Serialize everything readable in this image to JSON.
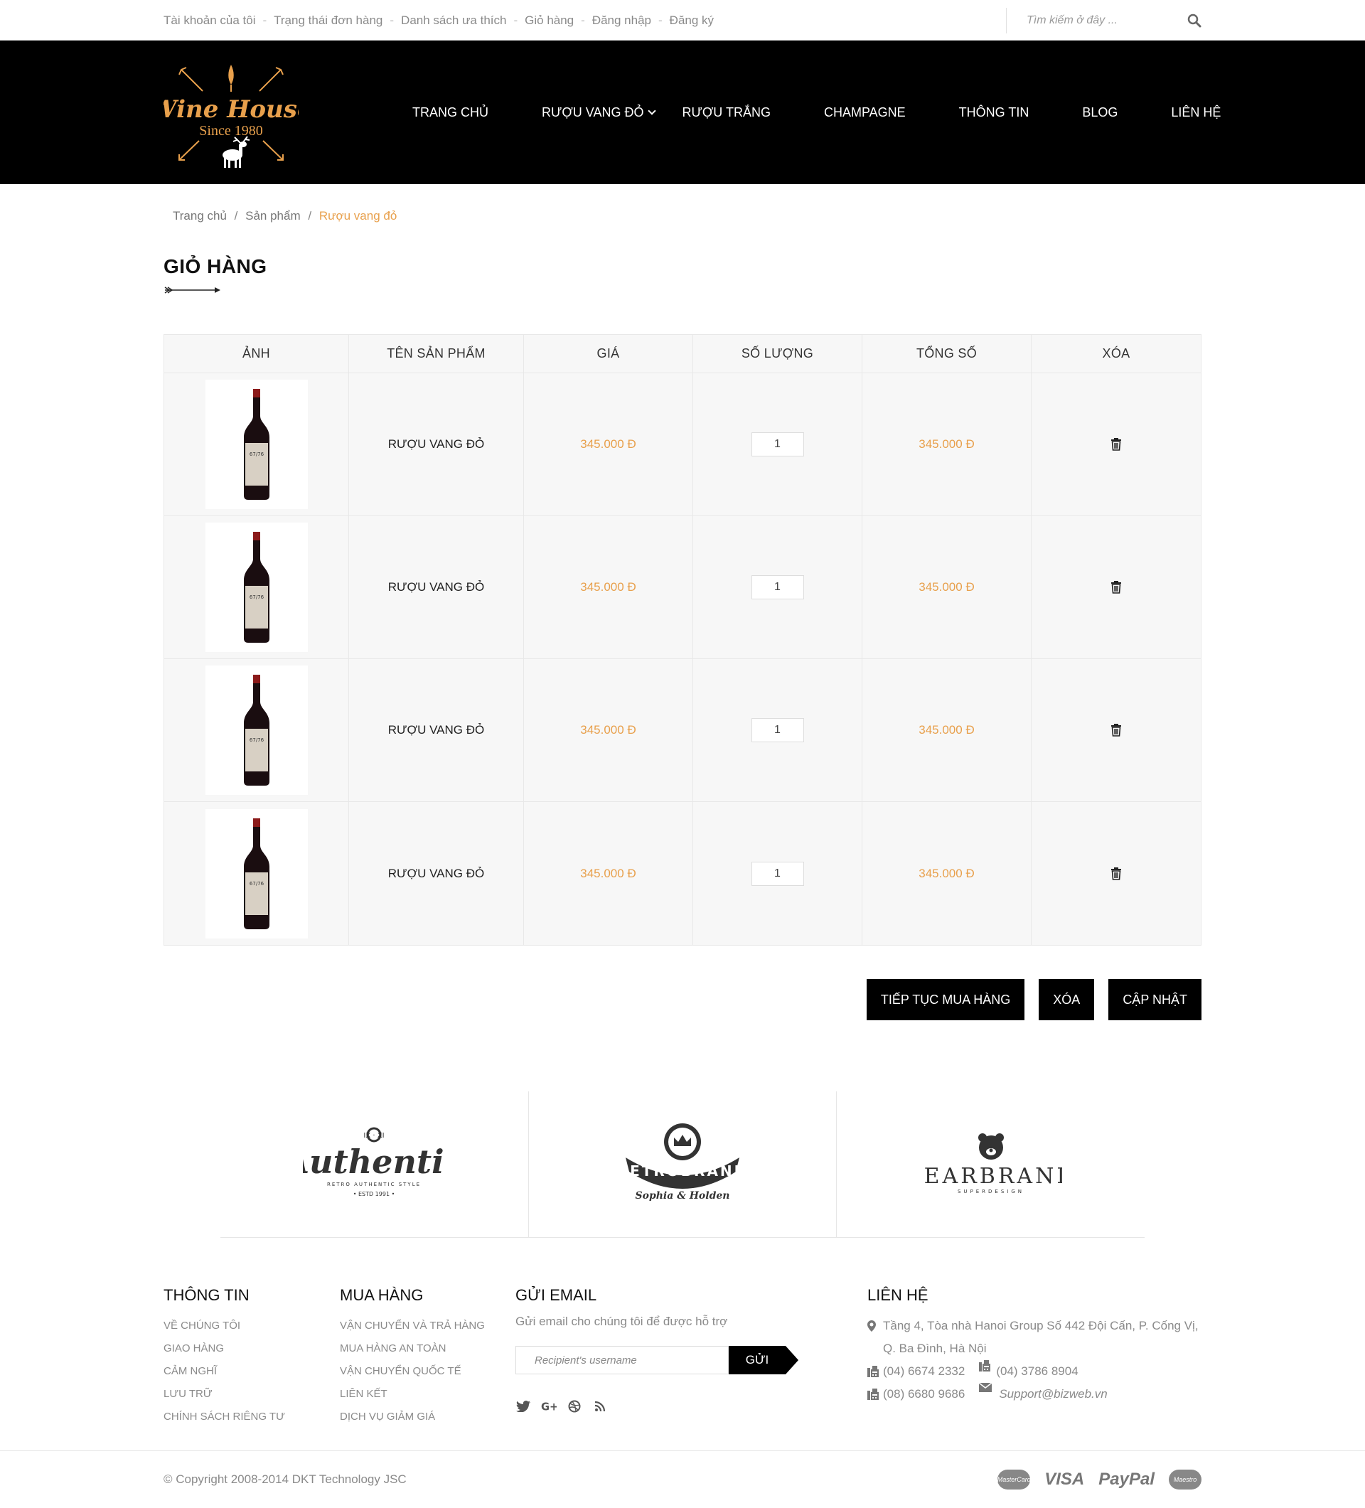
{
  "topbar": {
    "links": [
      "Tài khoản của tôi",
      "Trạng thái đơn hàng",
      "Danh sách ưa thích",
      "Giỏ hàng",
      "Đăng nhập",
      "Đăng ký"
    ],
    "separator": "-",
    "search_placeholder": "Tìm kiếm ở đây ..."
  },
  "logo": {
    "brand": "Wine House",
    "tagline": "Since 1980",
    "color": "#e8a04c"
  },
  "nav": {
    "items": [
      "TRANG CHỦ",
      "RƯỢU VANG ĐỎ",
      "RƯỢU TRẮNG",
      "CHAMPAGNE",
      "THÔNG TIN",
      "BLOG",
      "LIÊN HỆ"
    ]
  },
  "breadcrumb": {
    "home": "Trang chủ",
    "products": "Sản phẩm",
    "current": "Rượu vang đỏ",
    "sep": "/"
  },
  "page_title": "GIỎ HÀNG",
  "cart": {
    "headers": [
      "ẢNH",
      "TÊN SẢN PHẨM",
      "GIÁ",
      "SỐ LƯỢNG",
      "TỔNG SỐ",
      "XÓA"
    ],
    "rows": [
      {
        "name": "RƯỢU VANG ĐỎ",
        "price": "345.000 Đ",
        "qty": "1",
        "total": "345.000 Đ"
      },
      {
        "name": "RƯỢU VANG ĐỎ",
        "price": "345.000 Đ",
        "qty": "1",
        "total": "345.000 Đ"
      },
      {
        "name": "RƯỢU VANG ĐỎ",
        "price": "345.000 Đ",
        "qty": "1",
        "total": "345.000 Đ"
      },
      {
        "name": "RƯỢU VANG ĐỎ",
        "price": "345.000 Đ",
        "qty": "1",
        "total": "345.000 Đ"
      }
    ]
  },
  "actions": {
    "continue": "TIẾP TỤC MUA HÀNG",
    "clear": "XÓA",
    "update": "CẬP NHẬT"
  },
  "brands": [
    {
      "name": "Authentic",
      "sub": "RETRO AUTHENTIC STYLE",
      "year": "• ESTD 1991 •",
      "top": "IX · XI"
    },
    {
      "name": "RETROBRAND",
      "sub": "Sophia & Holden"
    },
    {
      "name": "BEARBRAND",
      "sub": "SUPERDESIGN"
    }
  ],
  "footer": {
    "info": {
      "title": "THÔNG TIN",
      "links": [
        "VỀ CHÚNG TÔI",
        "GIAO HÀNG",
        "CẢM NGHĨ",
        "LƯU TRỮ",
        "CHÍNH SÁCH RIÊNG TƯ"
      ]
    },
    "shop": {
      "title": "MUA HÀNG",
      "links": [
        "VẬN CHUYỂN VÀ TRẢ HÀNG",
        "MUA HÀNG AN TOÀN",
        "VẬN CHUYỂN QUỐC TẾ",
        "LIÊN KẾT",
        "DỊCH VỤ GIẢM GIÁ"
      ]
    },
    "email": {
      "title": "GỬI EMAIL",
      "desc": "Gửi email cho chúng tôi để được hỗ trợ",
      "placeholder": "Recipient's username",
      "button": "GỬI"
    },
    "contact": {
      "title": "LIÊN HỆ",
      "address": "Tầng 4, Tòa nhà Hanoi Group Số 442 Đội Cấn, P. Cống Vị, Q. Ba Đình, Hà Nội",
      "phone1": "(04) 6674 2332",
      "phone2": "(04) 3786 8904",
      "phone3": "(08) 6680 9686",
      "email": "Support@bizweb.vn"
    }
  },
  "copyright": "© Copyright 2008-2014 DKT Technology JSC",
  "payments": [
    "MasterCard",
    "VISA",
    "PayPal",
    "Maestro"
  ]
}
